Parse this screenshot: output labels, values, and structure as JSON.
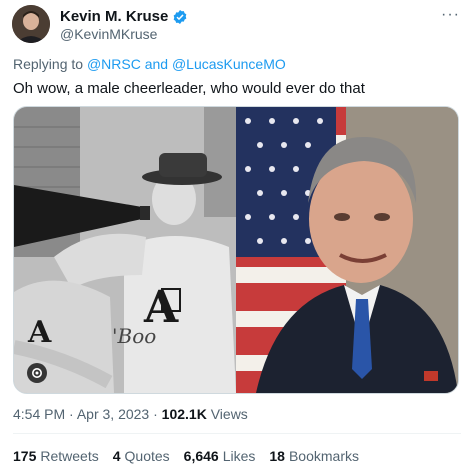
{
  "author": {
    "name": "Kevin M. Kruse",
    "handle": "@KevinMKruse",
    "verified": true
  },
  "reply": {
    "prefix": "Replying to",
    "handles": "@NRSC and @LucasKunceMO"
  },
  "tweet": {
    "text": "Oh wow, a male cheerleader, who would ever do that"
  },
  "media": {
    "images": [
      "cheerleader-photo",
      "portrait-photo"
    ],
    "badge_icon": "alt-badge-icon"
  },
  "meta": {
    "time": "4:54 PM",
    "sep1": "·",
    "date": "Apr 3, 2023",
    "sep2": "·",
    "views": "102.1K",
    "views_label": "Views"
  },
  "stats": {
    "retweets": "175",
    "retweets_label": "Retweets",
    "quotes": "4",
    "quotes_label": "Quotes",
    "likes": "6,646",
    "likes_label": "Likes",
    "bookmarks": "18",
    "bookmarks_label": "Bookmarks"
  },
  "colors": {
    "link": "#1d9bf0",
    "secondary_text": "#536471",
    "primary_text": "#0f1419"
  }
}
